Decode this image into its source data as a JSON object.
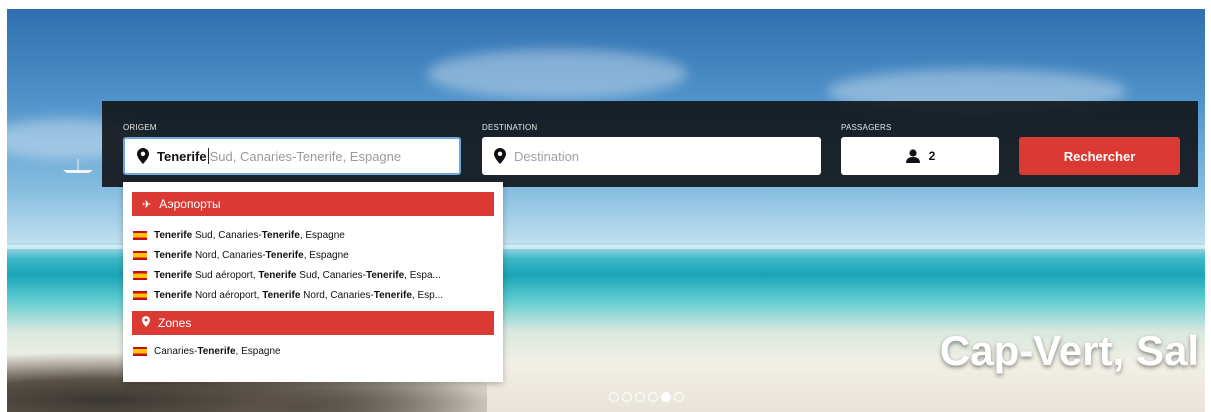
{
  "hero": {
    "caption": "Cap-Vert, Sal",
    "slide_count": 6,
    "active_slide": 5
  },
  "search": {
    "origin": {
      "label": "ORIGEM",
      "typed": "Tenerife",
      "autocomplete_hint": "Sud, Canaries-Tenerife, Espagne"
    },
    "destination": {
      "label": "DESTINATION",
      "placeholder": "Destination"
    },
    "passengers": {
      "label": "PASSAGERS",
      "count": "2"
    },
    "submit_label": "Rechercher"
  },
  "dropdown": {
    "groups": [
      {
        "title": "Аэропорты",
        "icon": "airplane-icon",
        "items": [
          "Tenerife Sud, Canaries-Tenerife, Espagne",
          "Tenerife Nord, Canaries-Tenerife, Espagne",
          "Tenerife Sud aéroport, Tenerife Sud, Canaries-Tenerife, Espa...",
          "Tenerife Nord aéroport, Tenerife Nord, Canaries-Tenerife, Esp..."
        ]
      },
      {
        "title": "Zones",
        "icon": "map-pin-icon",
        "items": [
          "Canaries-Tenerife, Espagne"
        ]
      }
    ]
  },
  "colors": {
    "accent": "#db3a34",
    "panel": "#111418",
    "focus_border": "#6fa8dc"
  }
}
